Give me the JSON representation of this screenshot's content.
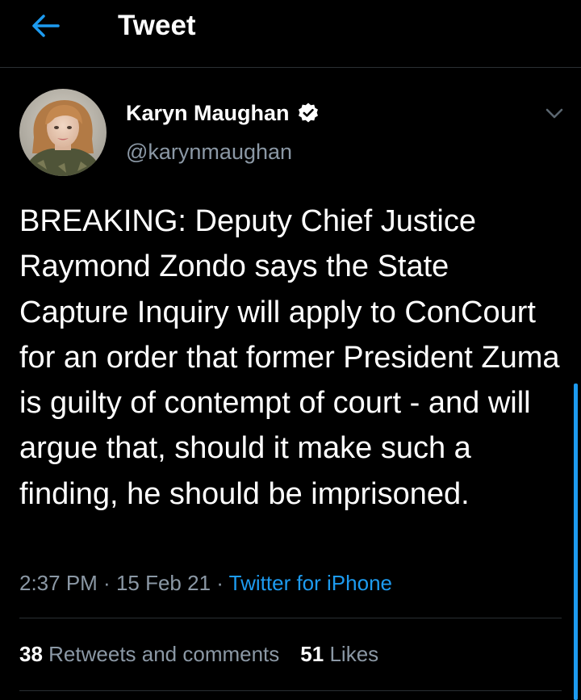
{
  "header": {
    "title": "Tweet"
  },
  "author": {
    "name": "Karyn Maughan",
    "handle": "@karynmaughan",
    "verified": true
  },
  "tweet": {
    "text": "BREAKING: Deputy Chief Justice Raymond Zondo says the State Capture Inquiry will apply to ConCourt for an order that former President Zuma is guilty of contempt of court - and will argue that, should it make such a finding, he should be imprisoned.",
    "time": "2:37 PM",
    "date": "15 Feb 21",
    "source": "Twitter for iPhone"
  },
  "stats": {
    "retweets_count": "38",
    "retweets_label": "Retweets and comments",
    "likes_count": "51",
    "likes_label": "Likes"
  },
  "colors": {
    "background": "#000000",
    "accent": "#1d9bf0",
    "secondary_text": "#8b98a5",
    "divider": "#2a2f33"
  },
  "icons": {
    "back": "arrow-left-icon",
    "verified": "verified-badge-icon",
    "more": "chevron-down-icon"
  }
}
